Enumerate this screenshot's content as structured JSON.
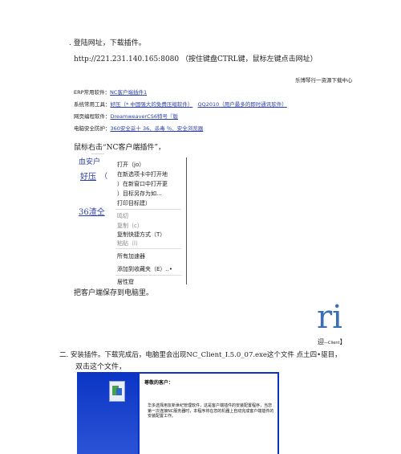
{
  "step1": {
    "heading": ". 登陆网址，下载插件。",
    "url_line": "http://221.231.140.165:8080 （按住键盘CTRL键，鼠标左键点击网址）",
    "download_center": "乐博琴行一资源下载中心",
    "rows": [
      {
        "label": "ERP常用软件：",
        "link": "NC客户端插件1"
      },
      {
        "label": "系统常用工具：",
        "link": "好压（* 中国强大的免费压缩软件）",
        "link2": "QQ2010（用户最多的即时通讯软件）"
      },
      {
        "label": "网页编程软件：",
        "link": "DreamweaverCS6特号『版"
      },
      {
        "label": "电脑安全防护：",
        "link": "360安全妥十 36、杀毒 ％、安全浏览器"
      }
    ],
    "right_click_note": "鼠标右击“NC客户端插件”，",
    "frag_top": "…‥…",
    "frag_1": "血安户",
    "frag_2": "好压",
    "frag_2b": "（",
    "frag_3": "36渣仝",
    "menu_items": [
      "打开（jo）",
      "在新选项卡中打开地",
      "）在新窗口中打开更",
      "）目标另存为如...",
      "打印目标建）",
      "鸣切",
      "复制（c）",
      "复制快捷方式（T）",
      "粘贴（l）",
      "所有加速器",
      "添加到收藏夹（E）..•",
      "居性窟"
    ],
    "save_note": "把客户端保存到电脑里。"
  },
  "ri_mark": "ri",
  "client_line": {
    "prefix": "迎",
    "suffix": "—Client",
    "bracket": "】"
  },
  "step2": {
    "line1": "二. 安装插件。下载完成后，电脑里会出现NC_Client_I.5.0_07.exe这个文件 点土四•驱目，",
    "line2": "双击这个文件，"
  },
  "installer": {
    "title": "尊敬的客户：",
    "body": "华多选择用友新世纪管理软件，这是客户端插件的安装配置程序，当您第一次连接NC服务器时，本程序将在您的机器上自动完成客户端插件的安装配置工作。"
  }
}
